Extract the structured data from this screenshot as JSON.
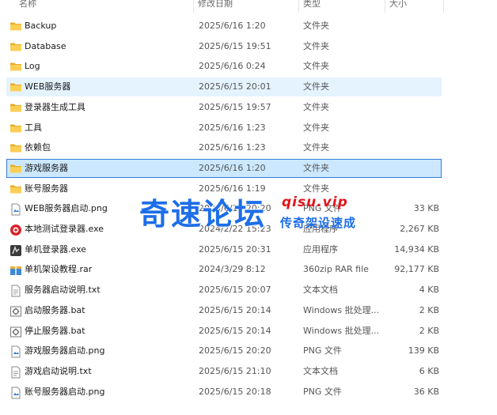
{
  "columns": {
    "name": "名称",
    "date": "修改日期",
    "type": "类型",
    "size": "大小"
  },
  "files": [
    {
      "name": "Backup",
      "date": "2025/6/16 1:20",
      "type": "文件夹",
      "size": "",
      "icon": "folder-icon"
    },
    {
      "name": "Database",
      "date": "2025/6/15 19:51",
      "type": "文件夹",
      "size": "",
      "icon": "folder-icon"
    },
    {
      "name": "Log",
      "date": "2025/6/16 0:24",
      "type": "文件夹",
      "size": "",
      "icon": "folder-icon"
    },
    {
      "name": "WEB服务器",
      "date": "2025/6/15 20:01",
      "type": "文件夹",
      "size": "",
      "icon": "folder-icon"
    },
    {
      "name": "登录器生成工具",
      "date": "2025/6/15 19:57",
      "type": "文件夹",
      "size": "",
      "icon": "folder-icon"
    },
    {
      "name": "工具",
      "date": "2025/6/16 1:23",
      "type": "文件夹",
      "size": "",
      "icon": "folder-icon"
    },
    {
      "name": "依赖包",
      "date": "2025/6/16 1:23",
      "type": "文件夹",
      "size": "",
      "icon": "folder-icon"
    },
    {
      "name": "游戏服务器",
      "date": "2025/6/16 1:20",
      "type": "文件夹",
      "size": "",
      "icon": "folder-icon"
    },
    {
      "name": "账号服务器",
      "date": "2025/6/16 1:19",
      "type": "文件夹",
      "size": "",
      "icon": "folder-icon"
    },
    {
      "name": "WEB服务器启动.png",
      "date": "2025/6/15 20:20",
      "type": "PNG 文件",
      "size": "33 KB",
      "icon": "image-file-icon"
    },
    {
      "name": "本地测试登录器.exe",
      "date": "2024/2/22 15:23",
      "type": "应用程序",
      "size": "2,267 KB",
      "icon": "red-app-icon"
    },
    {
      "name": "单机登录器.exe",
      "date": "2025/6/15 20:31",
      "type": "应用程序",
      "size": "14,934 KB",
      "icon": "app-icon"
    },
    {
      "name": "单机架设教程.rar",
      "date": "2024/3/29 8:12",
      "type": "360zip RAR file",
      "size": "92,177 KB",
      "icon": "archive-icon"
    },
    {
      "name": "服务器启动说明.txt",
      "date": "2025/6/15 20:07",
      "type": "文本文档",
      "size": "4 KB",
      "icon": "text-file-icon"
    },
    {
      "name": "启动服务器.bat",
      "date": "2025/6/15 20:14",
      "type": "Windows 批处理...",
      "size": "2 KB",
      "icon": "batch-file-icon"
    },
    {
      "name": "停止服务器.bat",
      "date": "2025/6/15 20:14",
      "type": "Windows 批处理...",
      "size": "2 KB",
      "icon": "batch-file-icon"
    },
    {
      "name": "游戏服务器启动.png",
      "date": "2025/6/15 20:20",
      "type": "PNG 文件",
      "size": "139 KB",
      "icon": "image-file-icon"
    },
    {
      "name": "游戏启动说明.txt",
      "date": "2025/6/15 21:10",
      "type": "文本文档",
      "size": "6 KB",
      "icon": "text-file-icon"
    },
    {
      "name": "账号服务器启动.png",
      "date": "2025/6/15 20:18",
      "type": "PNG 文件",
      "size": "36 KB",
      "icon": "image-file-icon"
    }
  ],
  "watermark": {
    "main": "奇速论坛",
    "url": "qisu.vip",
    "sub": "传奇架设速成"
  },
  "colors": {
    "hover": "#e5f3ff",
    "selected": "#cce8ff",
    "selected_border": "#3a7bd5",
    "folder": "#f8c94a",
    "watermark_blue": "#1d6ee8",
    "watermark_red": "#e0161b"
  }
}
